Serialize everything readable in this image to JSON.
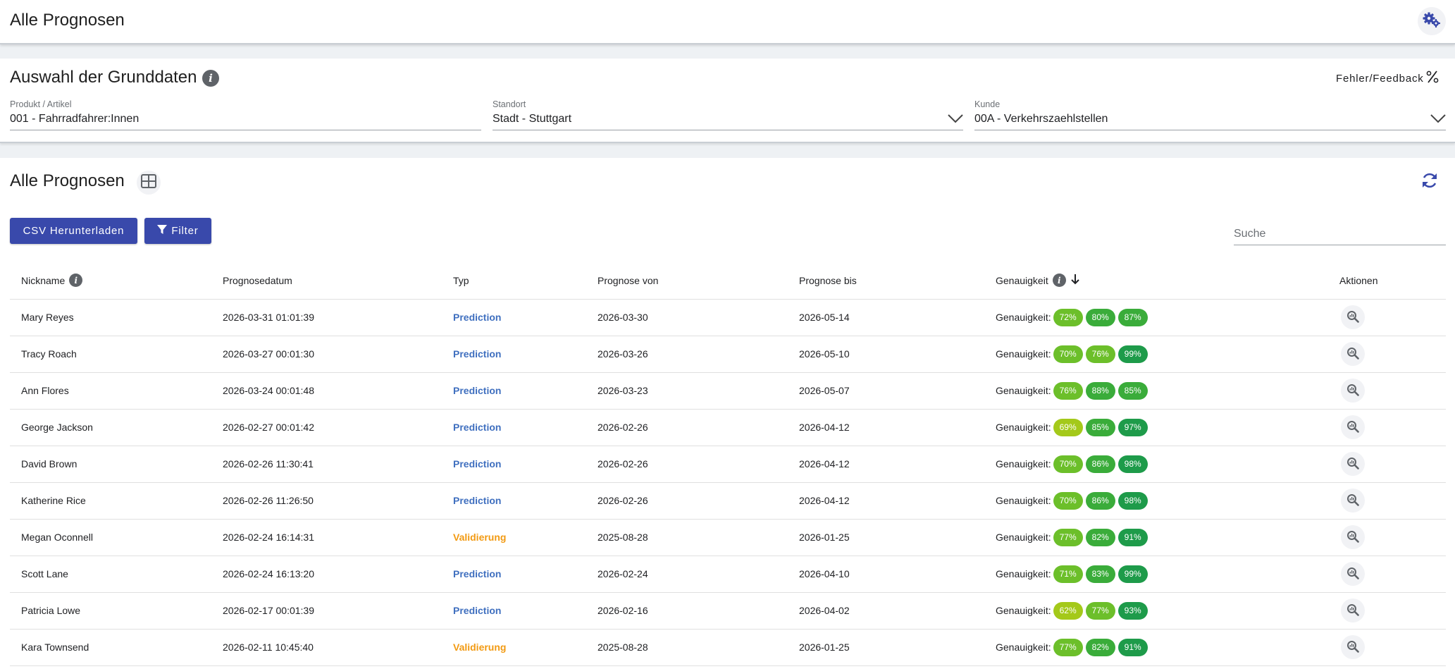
{
  "header": {
    "title": "Alle Prognosen",
    "settings_icon": "gears-icon"
  },
  "basedata": {
    "title": "Auswahl der Grunddaten",
    "feedback_label": "Fehler/Feedback",
    "product": {
      "label": "Produkt / Artikel",
      "value": "001 - Fahrradfahrer:Innen"
    },
    "location": {
      "label": "Standort",
      "value": "Stadt - Stuttgart"
    },
    "customer": {
      "label": "Kunde",
      "value": "00A - Verkehrszaehlstellen"
    }
  },
  "forecasts": {
    "title": "Alle Prognosen",
    "csv_button": "CSV Herunterladen",
    "filter_button": "Filter",
    "search_placeholder": "Suche",
    "columns": {
      "nickname": "Nickname",
      "date": "Prognosedatum",
      "type": "Typ",
      "from": "Prognose von",
      "to": "Prognose bis",
      "accuracy": "Genauigkeit",
      "actions": "Aktionen"
    },
    "accuracy_prefix": "Genauigkeit:",
    "colors": {
      "prediction": "#3f6fbf",
      "validation": "#f29a12",
      "accent": "#3949ab",
      "acc_low": "#a4c91a",
      "acc_mid": "#6cbf2a",
      "acc_high": "#3aac3a",
      "acc_top": "#1e9b4a"
    },
    "rows": [
      {
        "nickname": "Mary Reyes",
        "date": "2026-03-31 01:01:39",
        "type": "Prediction",
        "from": "2026-03-30",
        "to": "2026-05-14",
        "acc": [
          "72%",
          "80%",
          "87%"
        ]
      },
      {
        "nickname": "Tracy Roach",
        "date": "2026-03-27 00:01:30",
        "type": "Prediction",
        "from": "2026-03-26",
        "to": "2026-05-10",
        "acc": [
          "70%",
          "76%",
          "99%"
        ]
      },
      {
        "nickname": "Ann Flores",
        "date": "2026-03-24 00:01:48",
        "type": "Prediction",
        "from": "2026-03-23",
        "to": "2026-05-07",
        "acc": [
          "76%",
          "88%",
          "85%"
        ]
      },
      {
        "nickname": "George Jackson",
        "date": "2026-02-27 00:01:42",
        "type": "Prediction",
        "from": "2026-02-26",
        "to": "2026-04-12",
        "acc": [
          "69%",
          "85%",
          "97%"
        ]
      },
      {
        "nickname": "David Brown",
        "date": "2026-02-26 11:30:41",
        "type": "Prediction",
        "from": "2026-02-26",
        "to": "2026-04-12",
        "acc": [
          "70%",
          "86%",
          "98%"
        ]
      },
      {
        "nickname": "Katherine Rice",
        "date": "2026-02-26 11:26:50",
        "type": "Prediction",
        "from": "2026-02-26",
        "to": "2026-04-12",
        "acc": [
          "70%",
          "86%",
          "98%"
        ]
      },
      {
        "nickname": "Megan Oconnell",
        "date": "2026-02-24 16:14:31",
        "type": "Validierung",
        "from": "2025-08-28",
        "to": "2026-01-25",
        "acc": [
          "77%",
          "82%",
          "91%"
        ]
      },
      {
        "nickname": "Scott Lane",
        "date": "2026-02-24 16:13:20",
        "type": "Prediction",
        "from": "2026-02-24",
        "to": "2026-04-10",
        "acc": [
          "71%",
          "83%",
          "99%"
        ]
      },
      {
        "nickname": "Patricia Lowe",
        "date": "2026-02-17 00:01:39",
        "type": "Prediction",
        "from": "2026-02-16",
        "to": "2026-04-02",
        "acc": [
          "62%",
          "77%",
          "93%"
        ]
      },
      {
        "nickname": "Kara Townsend",
        "date": "2026-02-11 10:45:40",
        "type": "Validierung",
        "from": "2025-08-28",
        "to": "2026-01-25",
        "acc": [
          "77%",
          "82%",
          "91%"
        ]
      }
    ]
  }
}
